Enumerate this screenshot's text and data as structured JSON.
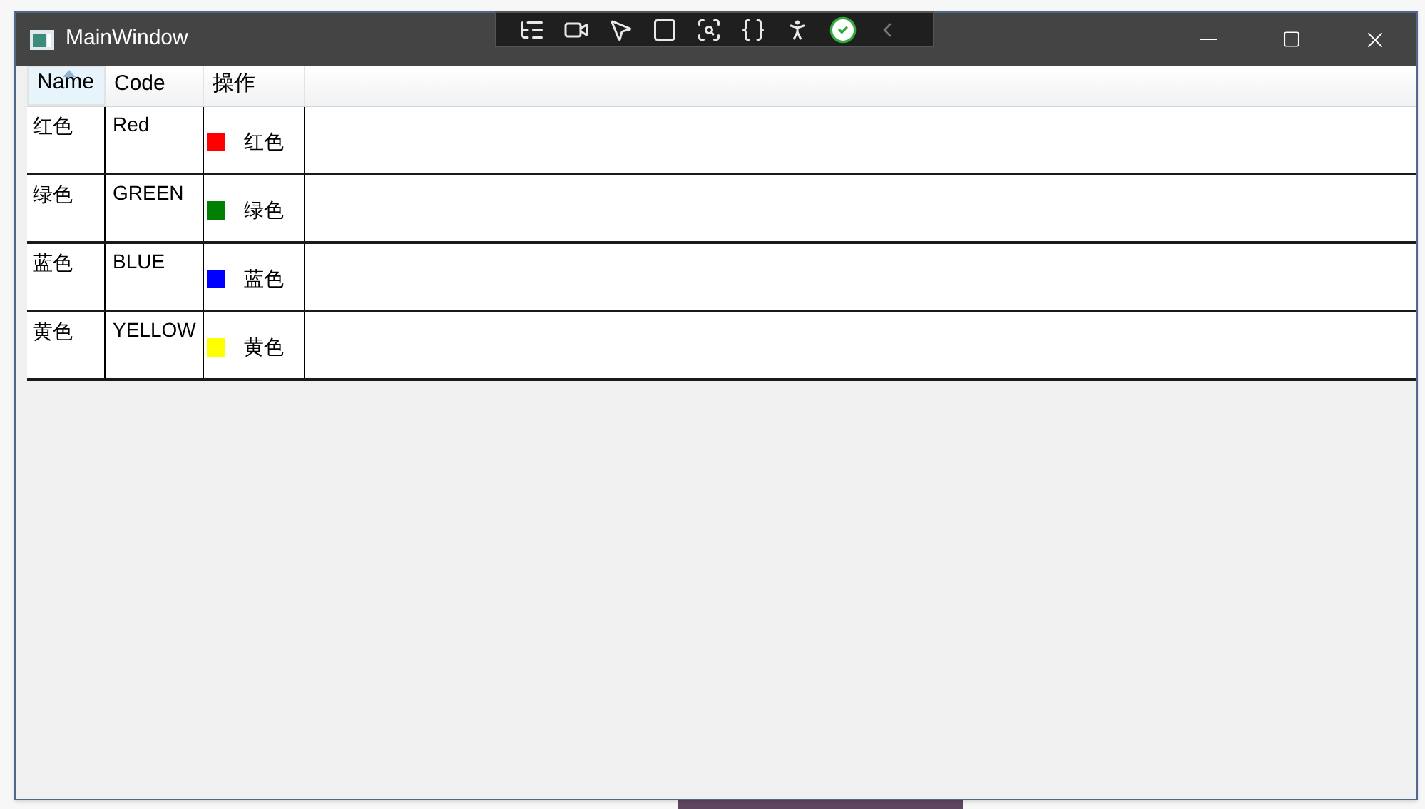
{
  "window": {
    "title": "MainWindow"
  },
  "debug_toolbar": {
    "tools": [
      {
        "kind": "tree"
      },
      {
        "kind": "video"
      },
      {
        "kind": "pointer"
      },
      {
        "kind": "frame"
      },
      {
        "kind": "select"
      },
      {
        "kind": "binding"
      },
      {
        "kind": "accessibility"
      },
      {
        "kind": "check"
      },
      {
        "kind": "collapse"
      }
    ]
  },
  "table": {
    "columns": [
      {
        "label": "Name",
        "sorted": true
      },
      {
        "label": "Code",
        "sorted": false
      },
      {
        "label": "操作",
        "sorted": false
      }
    ],
    "rows": [
      {
        "name": "红色",
        "code": "Red",
        "color": "#ff0000",
        "action": "红色"
      },
      {
        "name": "绿色",
        "code": "GREEN",
        "color": "#008000",
        "action": "绿色"
      },
      {
        "name": "蓝色",
        "code": "BLUE",
        "color": "#0000ff",
        "action": "蓝色"
      },
      {
        "name": "黄色",
        "code": "YELLOW",
        "color": "#ffff00",
        "action": "黄色"
      }
    ]
  }
}
